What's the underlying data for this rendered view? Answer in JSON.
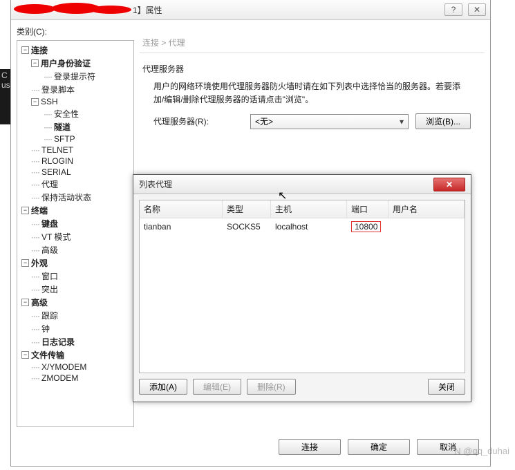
{
  "bg_left": {
    "line1": "C",
    "line2": "us"
  },
  "titlebar": {
    "suffix": "1】属性",
    "help": "?",
    "close": "✕"
  },
  "category_label": "类别(C):",
  "tree": {
    "connection": "连接",
    "user_auth": "用户身份验证",
    "login_prompts": "登录提示符",
    "login_scripts": "登录脚本",
    "ssh": "SSH",
    "security": "安全性",
    "tunnel": "隧道",
    "sftp": "SFTP",
    "telnet": "TELNET",
    "rlogin": "RLOGIN",
    "serial": "SERIAL",
    "proxy": "代理",
    "keepalive": "保持活动状态",
    "terminal": "终端",
    "keyboard": "键盘",
    "vt": "VT 模式",
    "advanced_t": "高级",
    "appearance": "外观",
    "window": "窗口",
    "highlight": "突出",
    "advanced": "高级",
    "trace": "跟踪",
    "bell": "钟",
    "logging": "日志记录",
    "file_transfer": "文件传输",
    "xymodem": "X/YMODEM",
    "zmodem": "ZMODEM"
  },
  "breadcrumb": "连接 > 代理",
  "group_title": "代理服务器",
  "description": "用户的网络环境使用代理服务器防火墙时请在如下列表中选择恰当的服务器。若要添加/编辑/删除代理服务器的话请点击\"浏览\"。",
  "proxy_label": "代理服务器(R):",
  "proxy_value": "<无>",
  "browse_btn": "浏览(B)...",
  "footer": {
    "connect": "连接",
    "ok": "确定",
    "cancel": "取消"
  },
  "list_dialog": {
    "title": "列表代理",
    "cols": {
      "name": "名称",
      "type": "类型",
      "host": "主机",
      "port": "端口",
      "user": "用户名"
    },
    "row": {
      "name": "tianban",
      "type": "SOCKS5",
      "host": "localhost",
      "port": "10800",
      "user": ""
    },
    "add": "添加(A)",
    "edit": "编辑(E)",
    "delete": "删除(R)",
    "close": "关闭"
  },
  "watermark": "N @qq_duhai"
}
